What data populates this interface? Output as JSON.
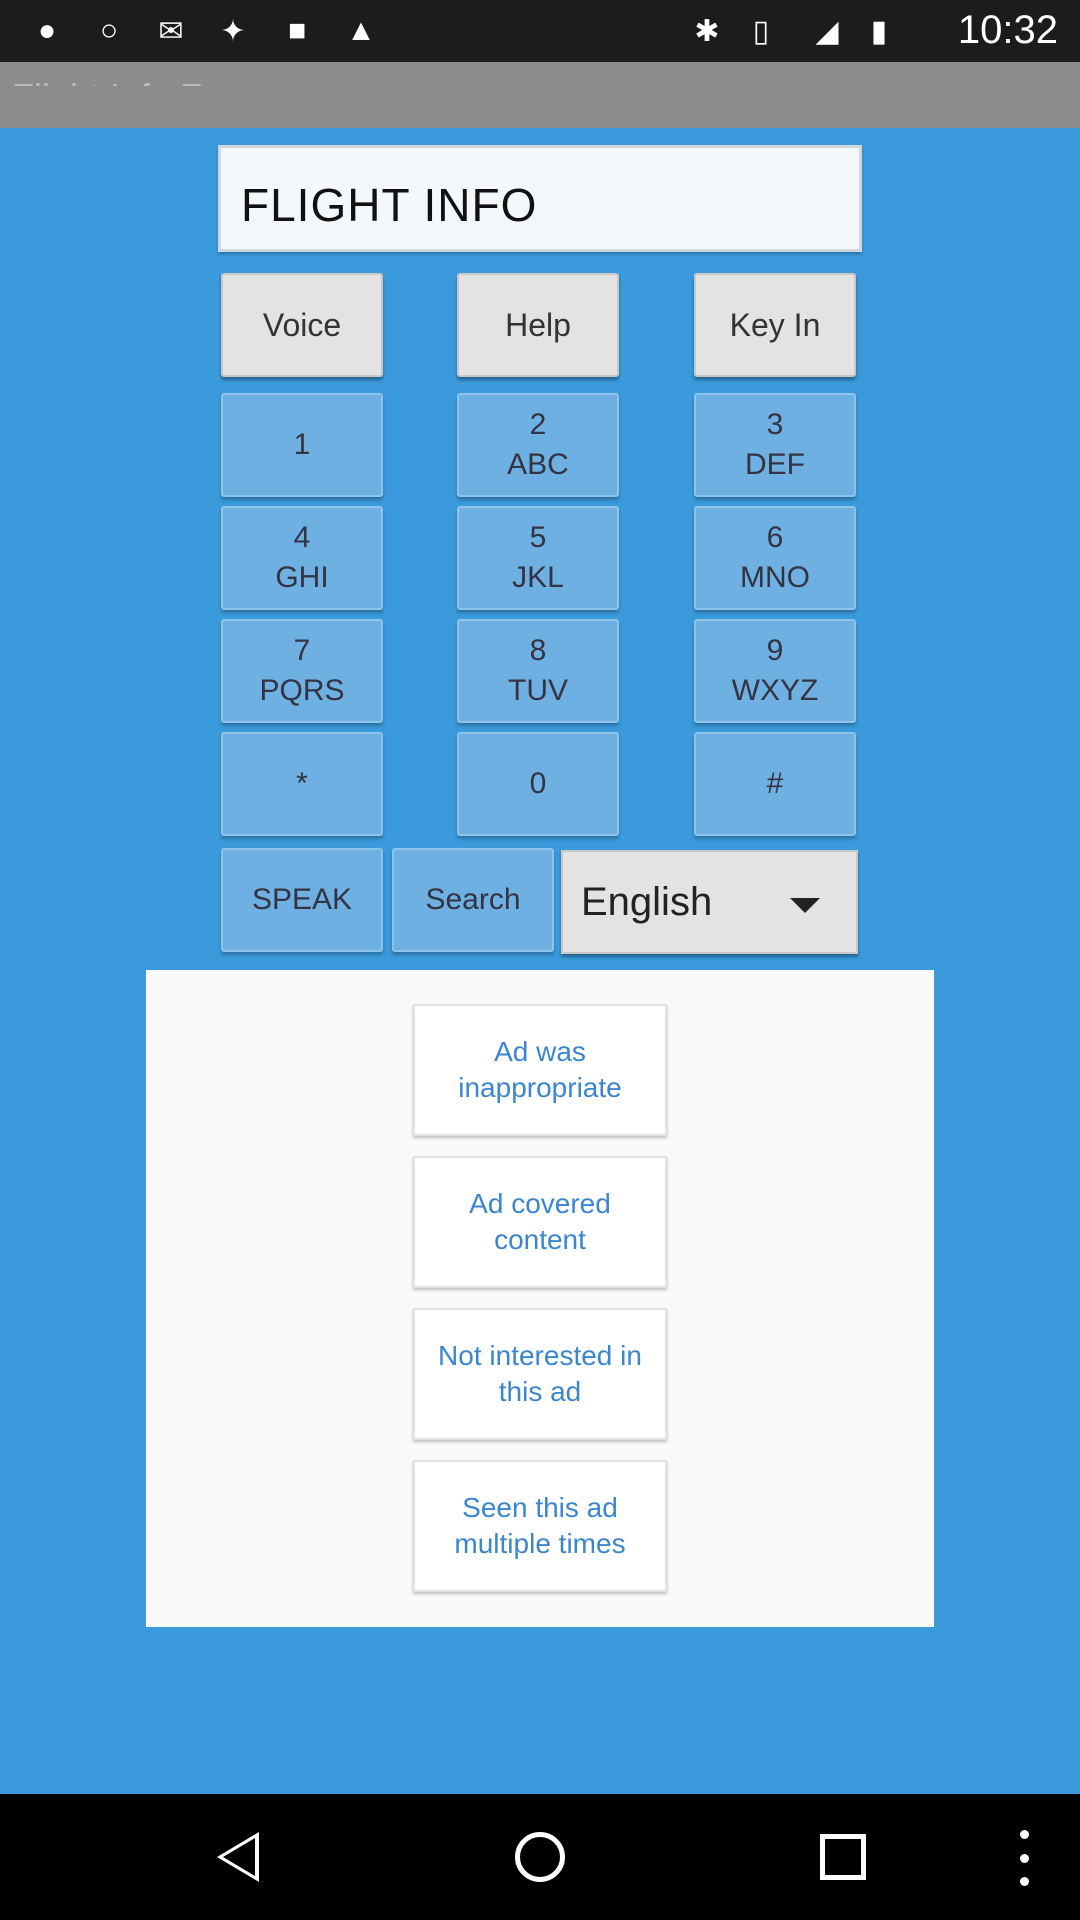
{
  "status_bar": {
    "time": "10:32",
    "left_icons": [
      "pin-icon",
      "circle-icon",
      "message-icon",
      "satellite-icon",
      "lock-icon",
      "android-icon"
    ],
    "right_icons": [
      "bluetooth-icon",
      "vibrate-icon",
      "signal-icon",
      "battery-icon"
    ]
  },
  "app_bar": {
    "title": "Flight Info Fr"
  },
  "title_field": {
    "value": "FLIGHT INFO"
  },
  "top_buttons": [
    {
      "label": "Voice"
    },
    {
      "label": "Help"
    },
    {
      "label": "Key In"
    }
  ],
  "keypad": [
    {
      "digit": "1",
      "letters": ""
    },
    {
      "digit": "2",
      "letters": "ABC"
    },
    {
      "digit": "3",
      "letters": "DEF"
    },
    {
      "digit": "4",
      "letters": "GHI"
    },
    {
      "digit": "5",
      "letters": "JKL"
    },
    {
      "digit": "6",
      "letters": "MNO"
    },
    {
      "digit": "7",
      "letters": "PQRS"
    },
    {
      "digit": "8",
      "letters": "TUV"
    },
    {
      "digit": "9",
      "letters": "WXYZ"
    },
    {
      "digit": "*",
      "letters": ""
    },
    {
      "digit": "0",
      "letters": ""
    },
    {
      "digit": "#",
      "letters": ""
    }
  ],
  "bottom_controls": {
    "speak_label": "SPEAK",
    "search_label": "Search",
    "language_selected": "English"
  },
  "ad_feedback": {
    "options": [
      {
        "label": "Ad was inappropriate"
      },
      {
        "label": "Ad covered content"
      },
      {
        "label": "Not interested in this ad"
      },
      {
        "label": "Seen this ad multiple times"
      }
    ]
  },
  "colors": {
    "background": "#3a9adb",
    "keypad_button": "#6fb0e2",
    "gray_button": "#e3e3e3",
    "ad_text": "#3b86cf"
  }
}
